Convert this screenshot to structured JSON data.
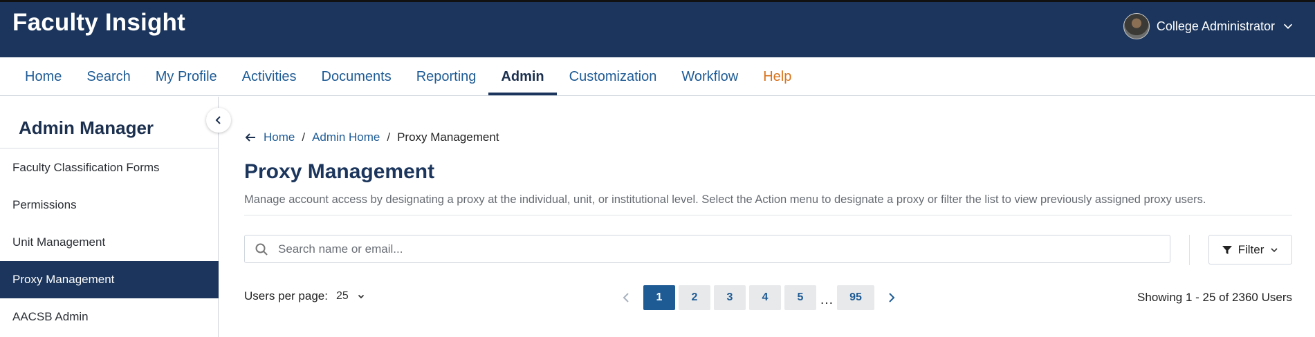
{
  "app": {
    "title": "Faculty Insight"
  },
  "user": {
    "name": "College Administrator",
    "avatar_icon": "user-avatar"
  },
  "nav": {
    "items": [
      {
        "label": "Home"
      },
      {
        "label": "Search"
      },
      {
        "label": "My Profile"
      },
      {
        "label": "Activities"
      },
      {
        "label": "Documents"
      },
      {
        "label": "Reporting"
      },
      {
        "label": "Admin"
      },
      {
        "label": "Customization"
      },
      {
        "label": "Workflow"
      },
      {
        "label": "Help"
      }
    ],
    "active": "Admin"
  },
  "sidebar": {
    "title": "Admin Manager",
    "items": [
      {
        "label": "Faculty Classification Forms"
      },
      {
        "label": "Permissions"
      },
      {
        "label": "Unit Management"
      },
      {
        "label": "Proxy Management"
      },
      {
        "label": "AACSB Admin"
      }
    ],
    "active": "Proxy Management"
  },
  "breadcrumb": {
    "home": "Home",
    "admin_home": "Admin Home",
    "current": "Proxy Management",
    "separator": "/"
  },
  "page": {
    "title": "Proxy Management",
    "description": "Manage account access by designating a proxy at the individual, unit, or institutional level. Select the Action menu to designate a proxy or filter the list to view previously assigned proxy users."
  },
  "search": {
    "placeholder": "Search name or email...",
    "value": ""
  },
  "filter": {
    "label": "Filter"
  },
  "pagination": {
    "per_page_label": "Users per page:",
    "per_page_value": "25",
    "pages": [
      "1",
      "2",
      "3",
      "4",
      "5"
    ],
    "ellipsis": "…",
    "last_page": "95",
    "current_page": "1",
    "showing": "Showing 1 - 25 of 2360 Users"
  },
  "colors": {
    "header_bg": "#1b355c",
    "link": "#1e5b95",
    "help": "#d9721a",
    "active_bg": "#1b355c"
  }
}
